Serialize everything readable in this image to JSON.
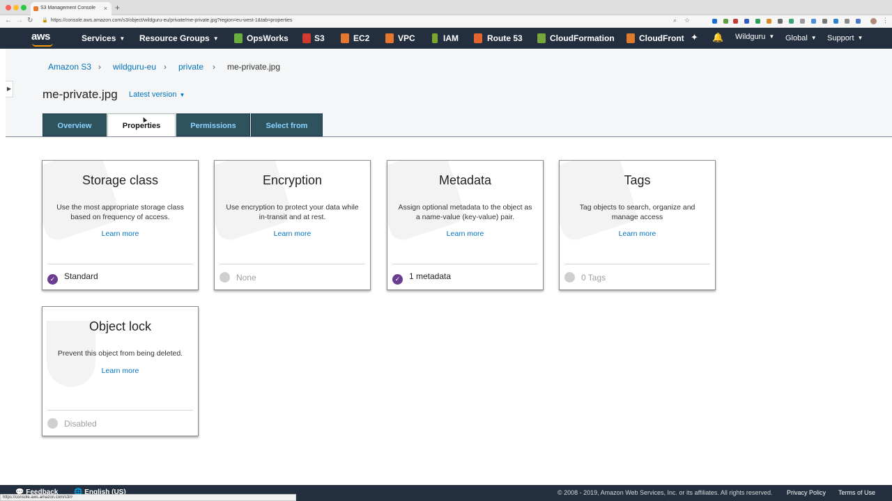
{
  "browser": {
    "tab_title": "S3 Management Console",
    "url": "https://console.aws.amazon.com/s3/object/wildguru-eu/private/me-private.jpg?region=eu-west-1&tab=properties",
    "status_url": "https://console.aws.amazon.com/s3/#"
  },
  "nav": {
    "logo": "aws",
    "services": "Services",
    "resource_groups": "Resource Groups",
    "shortcuts": [
      "OpsWorks",
      "S3",
      "EC2",
      "VPC",
      "IAM",
      "Route 53",
      "CloudFormation",
      "CloudFront"
    ],
    "account": "Wildguru",
    "region": "Global",
    "support": "Support",
    "colors": {
      "bar": "#232f3e",
      "accent": "#ff9900"
    }
  },
  "breadcrumb": [
    "Amazon S3",
    "wildguru-eu",
    "private",
    "me-private.jpg"
  ],
  "object": {
    "name": "me-private.jpg",
    "version": "Latest version"
  },
  "tabs": [
    "Overview",
    "Properties",
    "Permissions",
    "Select from"
  ],
  "cards": [
    {
      "title": "Storage class",
      "desc": "Use the most appropriate storage class based on frequency of access.",
      "link": "Learn more",
      "status": "Standard",
      "enabled": true
    },
    {
      "title": "Encryption",
      "desc": "Use encryption to protect your data while in-transit and at rest.",
      "link": "Learn more",
      "status": "None",
      "enabled": false
    },
    {
      "title": "Metadata",
      "desc": "Assign optional metadata to the object as a name-value (key-value) pair.",
      "link": "Learn more",
      "status": "1 metadata",
      "enabled": true
    },
    {
      "title": "Tags",
      "desc": "Tag objects to search, organize and manage access",
      "link": "Learn more",
      "status": "0 Tags",
      "enabled": false
    },
    {
      "title": "Object lock",
      "desc": "Prevent this object from being deleted.",
      "link": "Learn more",
      "status": "Disabled",
      "enabled": false
    }
  ],
  "footer": {
    "feedback": "Feedback",
    "language": "English (US)",
    "copyright": "© 2008 - 2019, Amazon Web Services, Inc. or its affiliates. All rights reserved.",
    "privacy": "Privacy Policy",
    "terms": "Terms of Use"
  }
}
